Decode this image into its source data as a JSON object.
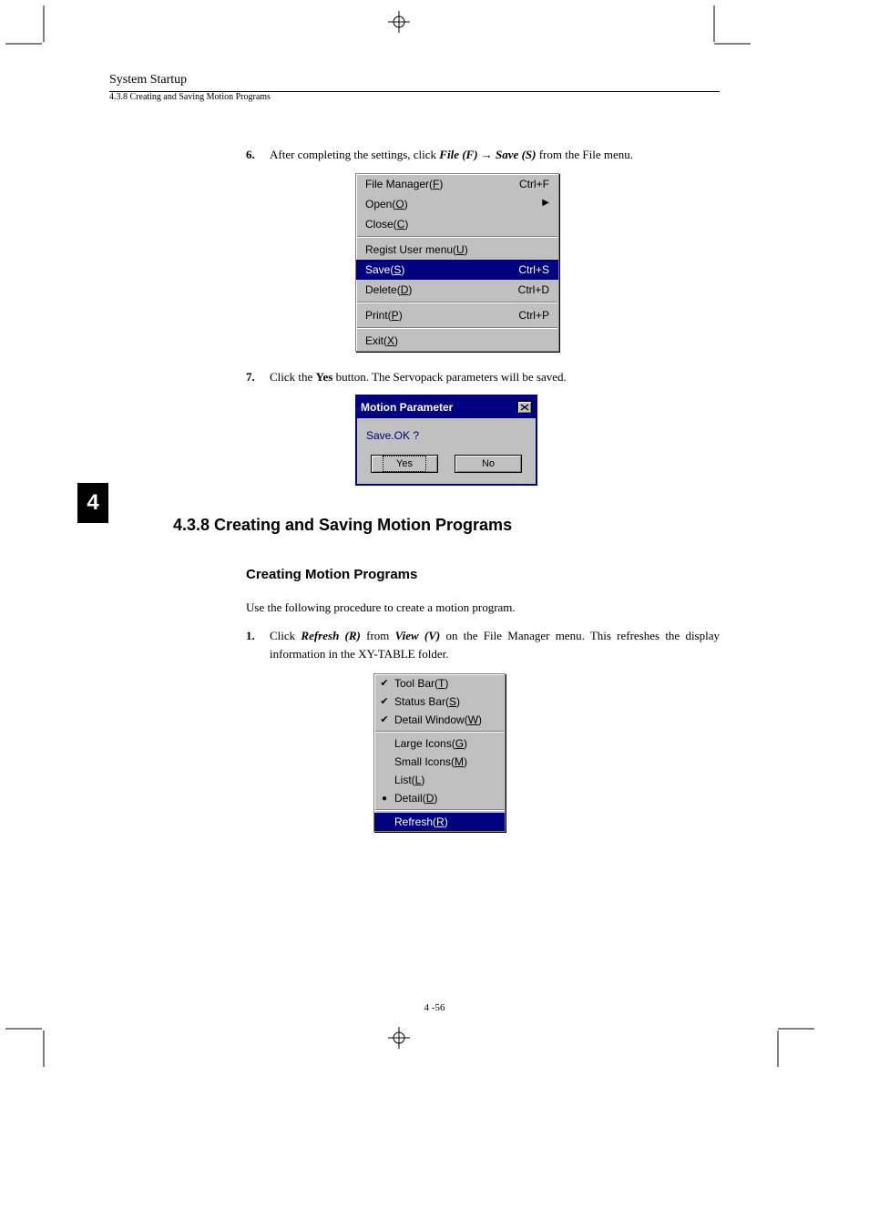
{
  "header": {
    "running": "System Startup",
    "sub": "4.3.8  Creating and Saving Motion Programs"
  },
  "chapter_tab": "4",
  "step6": {
    "num": "6.",
    "prefix": "After completing the settings, click ",
    "file": "File (F)",
    "arrow": " → ",
    "save": "Save (S)",
    "suffix": " from the File menu."
  },
  "file_menu": {
    "items": [
      {
        "label_pre": "File Manager(",
        "mn": "F",
        "label_post": ")",
        "accel": "Ctrl+F",
        "sub": false,
        "hl": false
      },
      {
        "label_pre": "Open(",
        "mn": "O",
        "label_post": ")",
        "accel": "",
        "sub": true,
        "hl": false
      },
      {
        "label_pre": "Close(",
        "mn": "C",
        "label_post": ")",
        "accel": "",
        "sub": false,
        "hl": false
      }
    ],
    "sep1": true,
    "items2": [
      {
        "label_pre": "Regist User menu(",
        "mn": "U",
        "label_post": ")",
        "accel": "",
        "sub": false,
        "hl": false
      },
      {
        "label_pre": "Save(",
        "mn": "S",
        "label_post": ")",
        "accel": "Ctrl+S",
        "sub": false,
        "hl": true
      },
      {
        "label_pre": "Delete(",
        "mn": "D",
        "label_post": ")",
        "accel": "Ctrl+D",
        "sub": false,
        "hl": false
      }
    ],
    "sep2": true,
    "items3": [
      {
        "label_pre": "Print(",
        "mn": "P",
        "label_post": ")",
        "accel": "Ctrl+P",
        "sub": false,
        "hl": false
      }
    ],
    "sep3": true,
    "items4": [
      {
        "label_pre": "Exit(",
        "mn": "X",
        "label_post": ")",
        "accel": "",
        "sub": false,
        "hl": false
      }
    ]
  },
  "step7": {
    "num": "7.",
    "prefix": "Click the ",
    "yes": "Yes",
    "suffix": " button. The Servopack parameters will be saved."
  },
  "dialog": {
    "title": "Motion Parameter",
    "body": "Save.OK ?",
    "yes": "Yes",
    "no": "No"
  },
  "h2": "4.3.8  Creating and Saving Motion Programs",
  "h3": "Creating Motion Programs",
  "p_intro": "Use the following procedure to create a motion program.",
  "step1": {
    "num": "1.",
    "prefix": "Click ",
    "refresh": "Refresh (R)",
    "mid": " from ",
    "view": "View (V)",
    "suffix": " on the File Manager menu. This refreshes the display information in the XY-TABLE folder."
  },
  "view_menu": {
    "items1": [
      {
        "mark": "check",
        "label_pre": "Tool Bar(",
        "mn": "T",
        "label_post": ")",
        "hl": false
      },
      {
        "mark": "check",
        "label_pre": "Status Bar(",
        "mn": "S",
        "label_post": ")",
        "hl": false
      },
      {
        "mark": "check",
        "label_pre": "Detail Window(",
        "mn": "W",
        "label_post": ")",
        "hl": false
      }
    ],
    "sep1": true,
    "items2": [
      {
        "mark": "",
        "label_pre": "Large Icons(",
        "mn": "G",
        "label_post": ")",
        "hl": false
      },
      {
        "mark": "",
        "label_pre": "Small Icons(",
        "mn": "M",
        "label_post": ")",
        "hl": false
      },
      {
        "mark": "",
        "label_pre": "List(",
        "mn": "L",
        "label_post": ")",
        "hl": false
      },
      {
        "mark": "bullet",
        "label_pre": "Detail(",
        "mn": "D",
        "label_post": ")",
        "hl": false
      }
    ],
    "sep2": true,
    "items3": [
      {
        "mark": "",
        "label_pre": "Refresh(",
        "mn": "R",
        "label_post": ")",
        "hl": true
      }
    ]
  },
  "page_num": "4 -56"
}
